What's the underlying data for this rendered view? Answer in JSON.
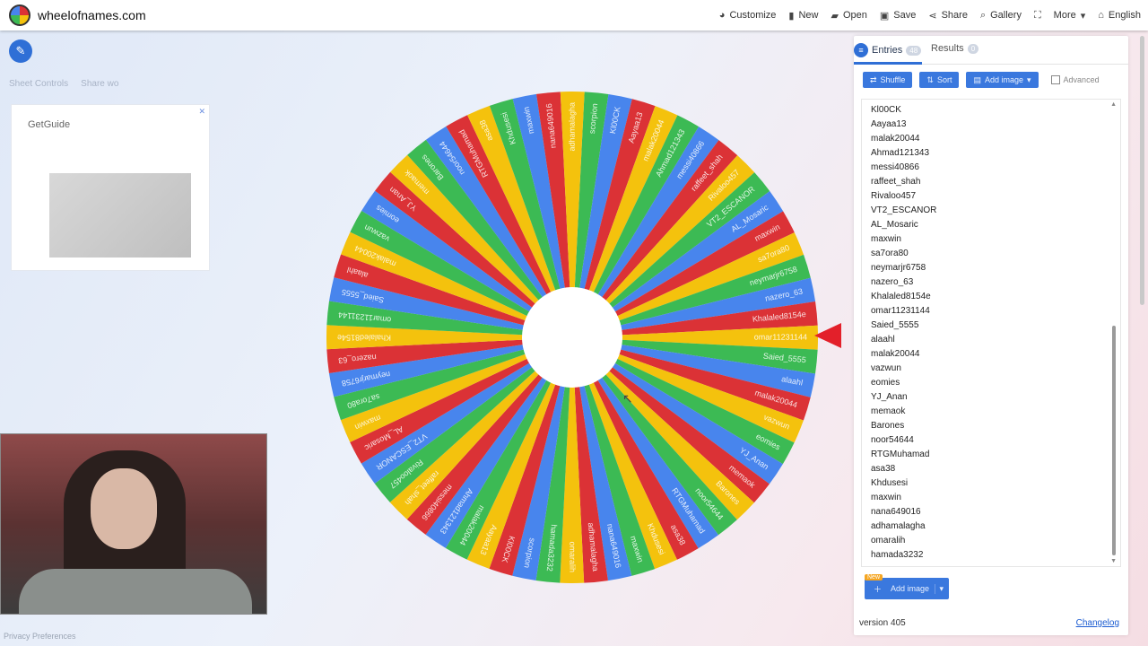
{
  "site": {
    "title": "wheelofnames.com"
  },
  "nav": [
    {
      "icon": "palette-icon",
      "label": "Customize"
    },
    {
      "icon": "file-icon",
      "label": "New"
    },
    {
      "icon": "folder-icon",
      "label": "Open"
    },
    {
      "icon": "save-icon",
      "label": "Save"
    },
    {
      "icon": "share-icon",
      "label": "Share"
    },
    {
      "icon": "search-icon",
      "label": "Gallery"
    },
    {
      "icon": "fullscreen-icon",
      "label": ""
    },
    {
      "icon": "",
      "label": "More"
    },
    {
      "icon": "globe-icon",
      "label": "English"
    }
  ],
  "left": {
    "links": [
      "Sheet Controls",
      "Share wo"
    ],
    "ad_brand": "GetGuide"
  },
  "panel": {
    "tabs": {
      "entries": "Entries",
      "entries_count": "48",
      "results": "Results",
      "results_count": "0"
    },
    "actions": {
      "shuffle": "Shuffle",
      "sort": "Sort",
      "add_image": "Add image",
      "advanced": "Advanced"
    },
    "entries": [
      "scorpion",
      "Kl00CK",
      "Aayaa13",
      "malak20044",
      "Ahmad121343",
      "messi40866",
      "raffeet_shah",
      "Rivaloo457",
      "VT2_ESCANOR",
      "AL_Mosaric",
      "maxwin",
      "sa7ora80",
      "neymarjr6758",
      "nazero_63",
      "Khalaled8154e",
      "omar11231144",
      "Saied_5555",
      "alaahl",
      "malak20044",
      "vazwun",
      "eomies",
      "YJ_Anan",
      "memaok",
      "Barones",
      "noor54644",
      "RTGMuhamad",
      "asa38",
      "Khdusesi",
      "maxwin",
      "nana649016",
      "adhamalagha",
      "omaralih",
      "hamada3232"
    ],
    "new_badge": "New",
    "add_image_button": "Add image",
    "version": "version 405",
    "changelog": "Changelog"
  },
  "colors": {
    "accent": "#2f6fd6",
    "wheel": [
      "#3cba54",
      "#4885ed",
      "#db3236",
      "#f4c20d"
    ]
  }
}
